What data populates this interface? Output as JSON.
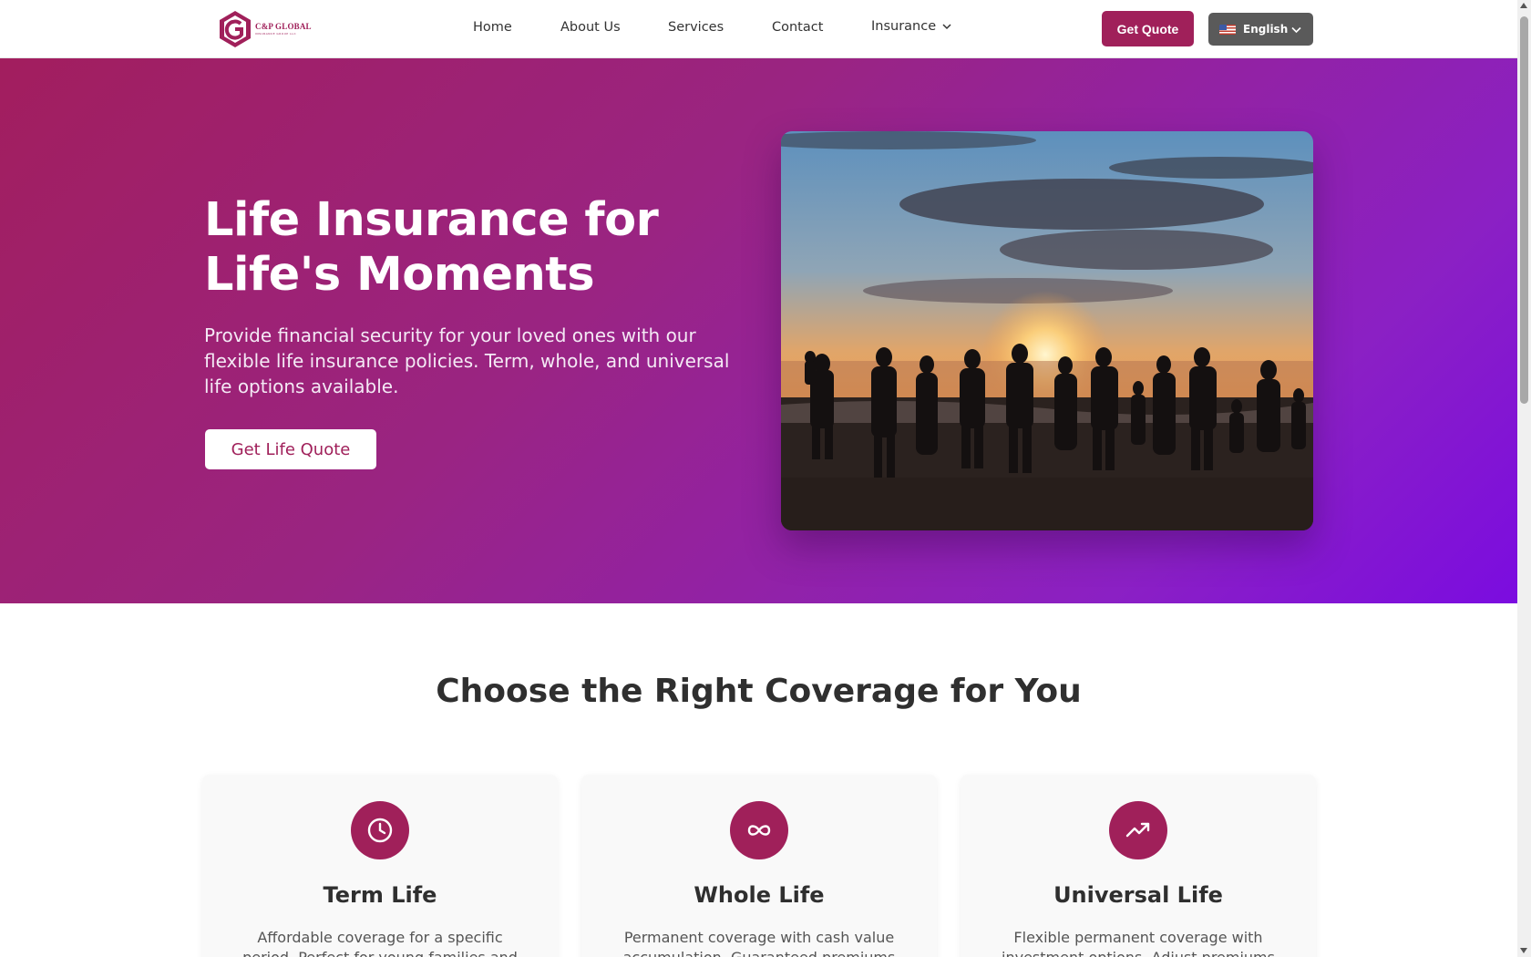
{
  "brand": {
    "name": "C&P GLOBAL",
    "tagline": "INSURANCE GROUP LLC",
    "color": "#a0205a"
  },
  "nav": {
    "items": [
      {
        "label": "Home"
      },
      {
        "label": "About Us"
      },
      {
        "label": "Services"
      },
      {
        "label": "Contact"
      }
    ],
    "insurance_label": "Insurance",
    "insurance_icon": "chevron-down-icon",
    "cta_label": "Get Quote",
    "language": {
      "label": "English",
      "flag": "us-flag-icon",
      "icon": "chevron-down-icon"
    }
  },
  "hero": {
    "title": "Life Insurance for Life's Moments",
    "description": "Provide financial security for your loved ones with our flexible life insurance policies. Term, whole, and universal life options available.",
    "cta_label": "Get Life Quote",
    "image": "family-on-beach-at-sunset-photo",
    "gradient": [
      "#a21e5e",
      "#9a2482",
      "#8b20c4",
      "#7b0ce0"
    ]
  },
  "coverage": {
    "title": "Choose the Right Coverage for You",
    "cards": [
      {
        "title": "Term Life",
        "icon": "clock-icon",
        "description": "Affordable coverage for a specific period. Perfect for young families and mortgage"
      },
      {
        "title": "Whole Life",
        "icon": "infinity-icon",
        "description": "Permanent coverage with cash value accumulation. Guaranteed premiums and"
      },
      {
        "title": "Universal Life",
        "icon": "trending-up-icon",
        "description": "Flexible permanent coverage with investment options. Adjust premiums and"
      }
    ]
  },
  "colors": {
    "accent": "#a0205a",
    "language_button": "#5a5a5a"
  }
}
